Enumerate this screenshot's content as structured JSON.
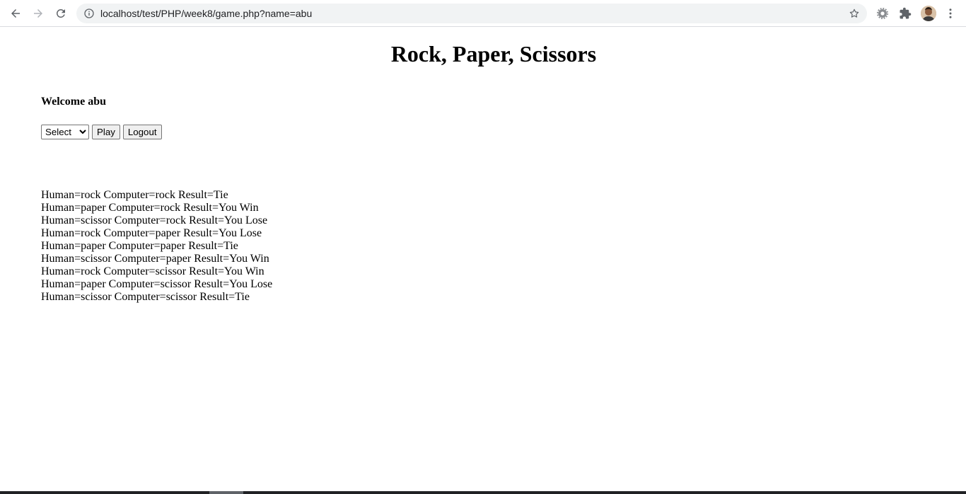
{
  "browser": {
    "url": "localhost/test/PHP/week8/game.php?name=abu",
    "icons": {
      "back": "arrow-left-icon",
      "forward": "arrow-right-icon",
      "reload": "reload-icon",
      "info": "info-icon",
      "bookmark": "star-icon",
      "extension1": "gear-icon",
      "extension2": "puzzle-icon",
      "profile": "avatar",
      "menu": "kebab-menu-icon"
    }
  },
  "page": {
    "title": "Rock, Paper, Scissors",
    "welcome": "Welcome abu",
    "select_value": "Select",
    "play_label": "Play",
    "logout_label": "Logout",
    "results": [
      "Human=rock Computer=rock Result=Tie",
      "Human=paper Computer=rock Result=You Win",
      "Human=scissor Computer=rock Result=You Lose",
      "Human=rock Computer=paper Result=You Lose",
      "Human=paper Computer=paper Result=Tie",
      "Human=scissor Computer=paper Result=You Win",
      "Human=rock Computer=scissor Result=You Win",
      "Human=paper Computer=scissor Result=You Lose",
      "Human=scissor Computer=scissor Result=Tie"
    ]
  }
}
